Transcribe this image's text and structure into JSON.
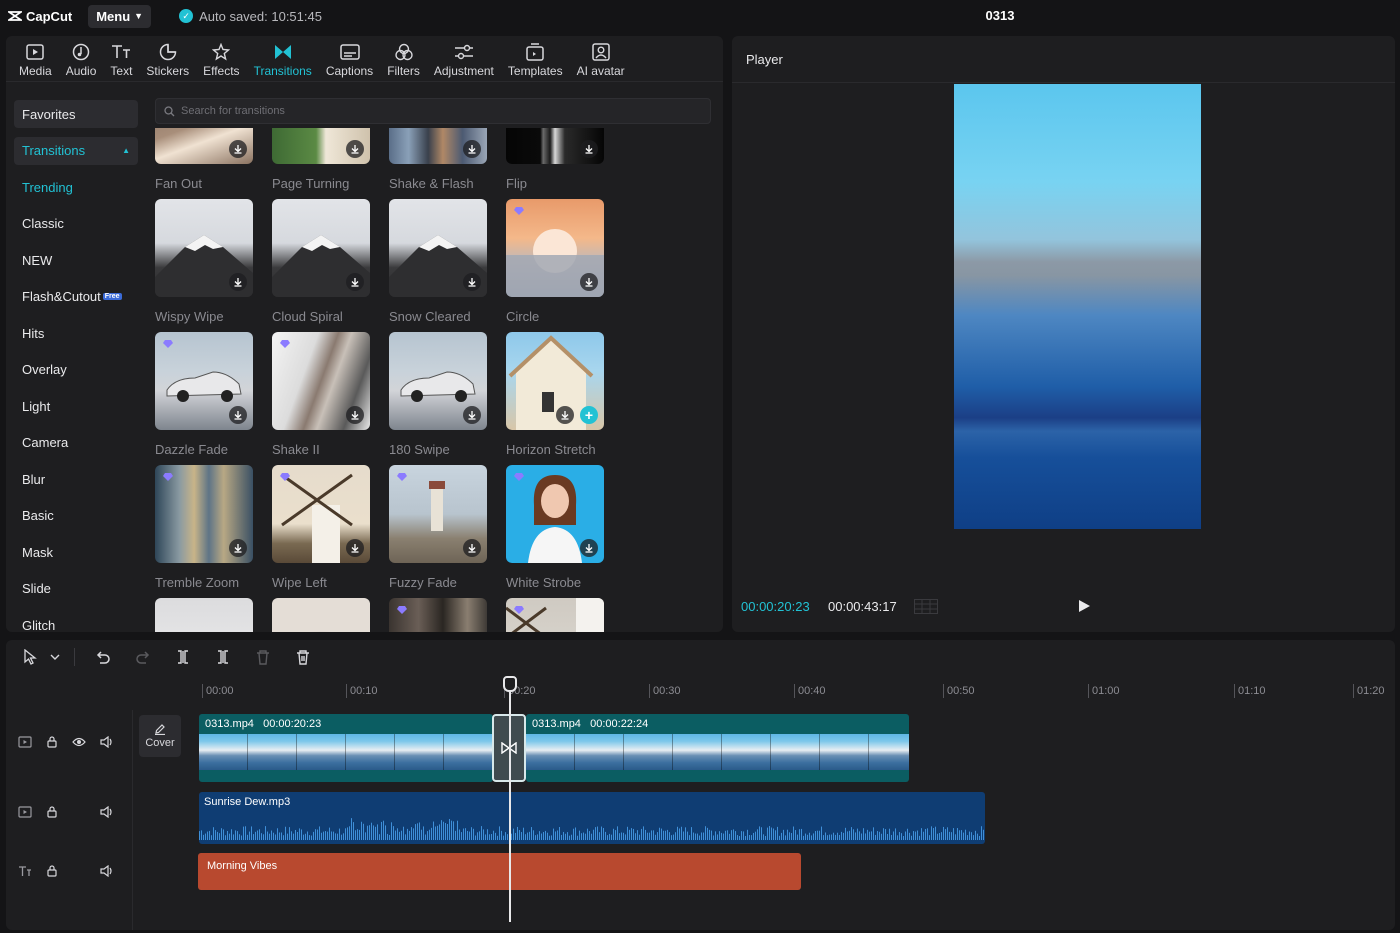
{
  "app": {
    "logo_text": "CapCut",
    "menu_label": "Menu",
    "autosave_text": "Auto saved: 10:51:45",
    "project_title": "0313",
    "accent_color": "#22c2d4"
  },
  "toolbar": {
    "items": [
      {
        "label": "Media",
        "icon": "media-icon"
      },
      {
        "label": "Audio",
        "icon": "audio-icon"
      },
      {
        "label": "Text",
        "icon": "text-icon"
      },
      {
        "label": "Stickers",
        "icon": "stickers-icon"
      },
      {
        "label": "Effects",
        "icon": "effects-icon"
      },
      {
        "label": "Transitions",
        "icon": "transitions-icon",
        "active": true
      },
      {
        "label": "Captions",
        "icon": "captions-icon"
      },
      {
        "label": "Filters",
        "icon": "filters-icon"
      },
      {
        "label": "Adjustment",
        "icon": "adjustment-icon"
      },
      {
        "label": "Templates",
        "icon": "templates-icon"
      },
      {
        "label": "AI avatar",
        "icon": "ai-avatar-icon"
      }
    ]
  },
  "categories": {
    "favorites": "Favorites",
    "transitions": "Transitions",
    "items": [
      "Trending",
      "Classic",
      "NEW",
      "Flash&Cutout",
      "Hits",
      "Overlay",
      "Light",
      "Camera",
      "Blur",
      "Basic",
      "Mask",
      "Slide",
      "Glitch"
    ],
    "free_badge": "Free"
  },
  "search": {
    "placeholder": "Search for transitions"
  },
  "transitions": [
    [
      "Fan Out",
      "Page Turning",
      "Shake & Flash",
      "Flip"
    ],
    [
      "Wispy Wipe",
      "Cloud Spiral",
      "Snow Cleared",
      "Circle"
    ],
    [
      "Dazzle Fade",
      "Shake II",
      "180 Swipe",
      "Horizon Stretch"
    ],
    [
      "Tremble Zoom",
      "Wipe Left",
      "Fuzzy Fade",
      "White Strobe"
    ]
  ],
  "player": {
    "title": "Player",
    "current_time": "00:00:20:23",
    "duration": "00:00:43:17"
  },
  "timeline": {
    "ruler": [
      "00:00",
      "00:10",
      "00:20",
      "00:30",
      "00:40",
      "00:50",
      "01:00",
      "01:10",
      "01:20"
    ],
    "cover_label": "Cover",
    "video_clip_1": {
      "name": "0313.mp4",
      "duration": "00:00:20:23"
    },
    "video_clip_2": {
      "name": "0313.mp4",
      "duration": "00:00:22:24"
    },
    "audio_clip": {
      "name": "Sunrise Dew.mp3"
    },
    "text_clip": {
      "name": "Morning Vibes"
    }
  }
}
